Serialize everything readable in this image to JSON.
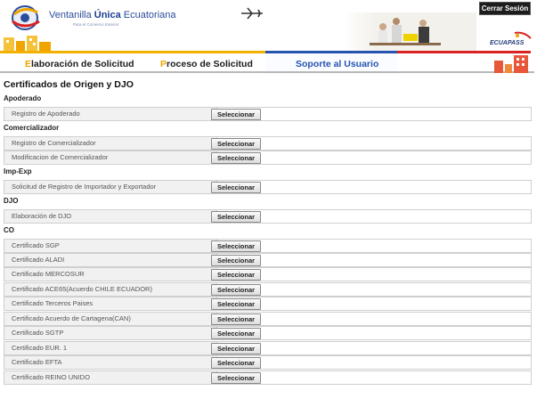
{
  "header": {
    "logo_title_part1": "Ventanilla ",
    "logo_title_part2": "Única",
    "logo_title_part3": " Ecuatoriana",
    "logo_subtitle": "Para el Comercio Exterior",
    "logout_label": "Cerrar Sesión",
    "brand_right": "ECUAPASS"
  },
  "nav": {
    "tabs": [
      {
        "accent": "E",
        "label": "laboración de Solicitud"
      },
      {
        "accent": "P",
        "label": "roceso de Solicitud"
      },
      {
        "accent": "",
        "label": "Soporte al Usuario"
      },
      {
        "accent": "",
        "label": ""
      }
    ]
  },
  "page": {
    "title": "Certificados de Origen y DJO"
  },
  "button_label": "Seleccionar",
  "sections": [
    {
      "title": "Apoderado",
      "items": [
        "Registro de Apoderado"
      ]
    },
    {
      "title": "Comercializador",
      "items": [
        "Registro de Comercializador",
        "Modificacion de Comercializador"
      ]
    },
    {
      "title": "Imp-Exp",
      "items": [
        "Solicitud de Registro de Importador y Exportador"
      ]
    },
    {
      "title": "DJO",
      "items": [
        "Elaboración de DJO"
      ]
    },
    {
      "title": "CO",
      "items": [
        "Certificado SGP",
        "Certificado ALADI",
        "Certificado MERCOSUR",
        "Certificado ACE65(Acuerdo CHILE ECUADOR)",
        "Certificado Terceros Paises",
        "Certificado Acuerdo de Cartagena(CAN)",
        "Certificado SGTP",
        "Certificado EUR. 1",
        "Certificado EFTA",
        "Certificado REINO UNIDO"
      ]
    }
  ],
  "colors": {
    "accent_yellow": "#f2b100",
    "accent_blue": "#2553b0",
    "accent_red": "#d92323"
  }
}
